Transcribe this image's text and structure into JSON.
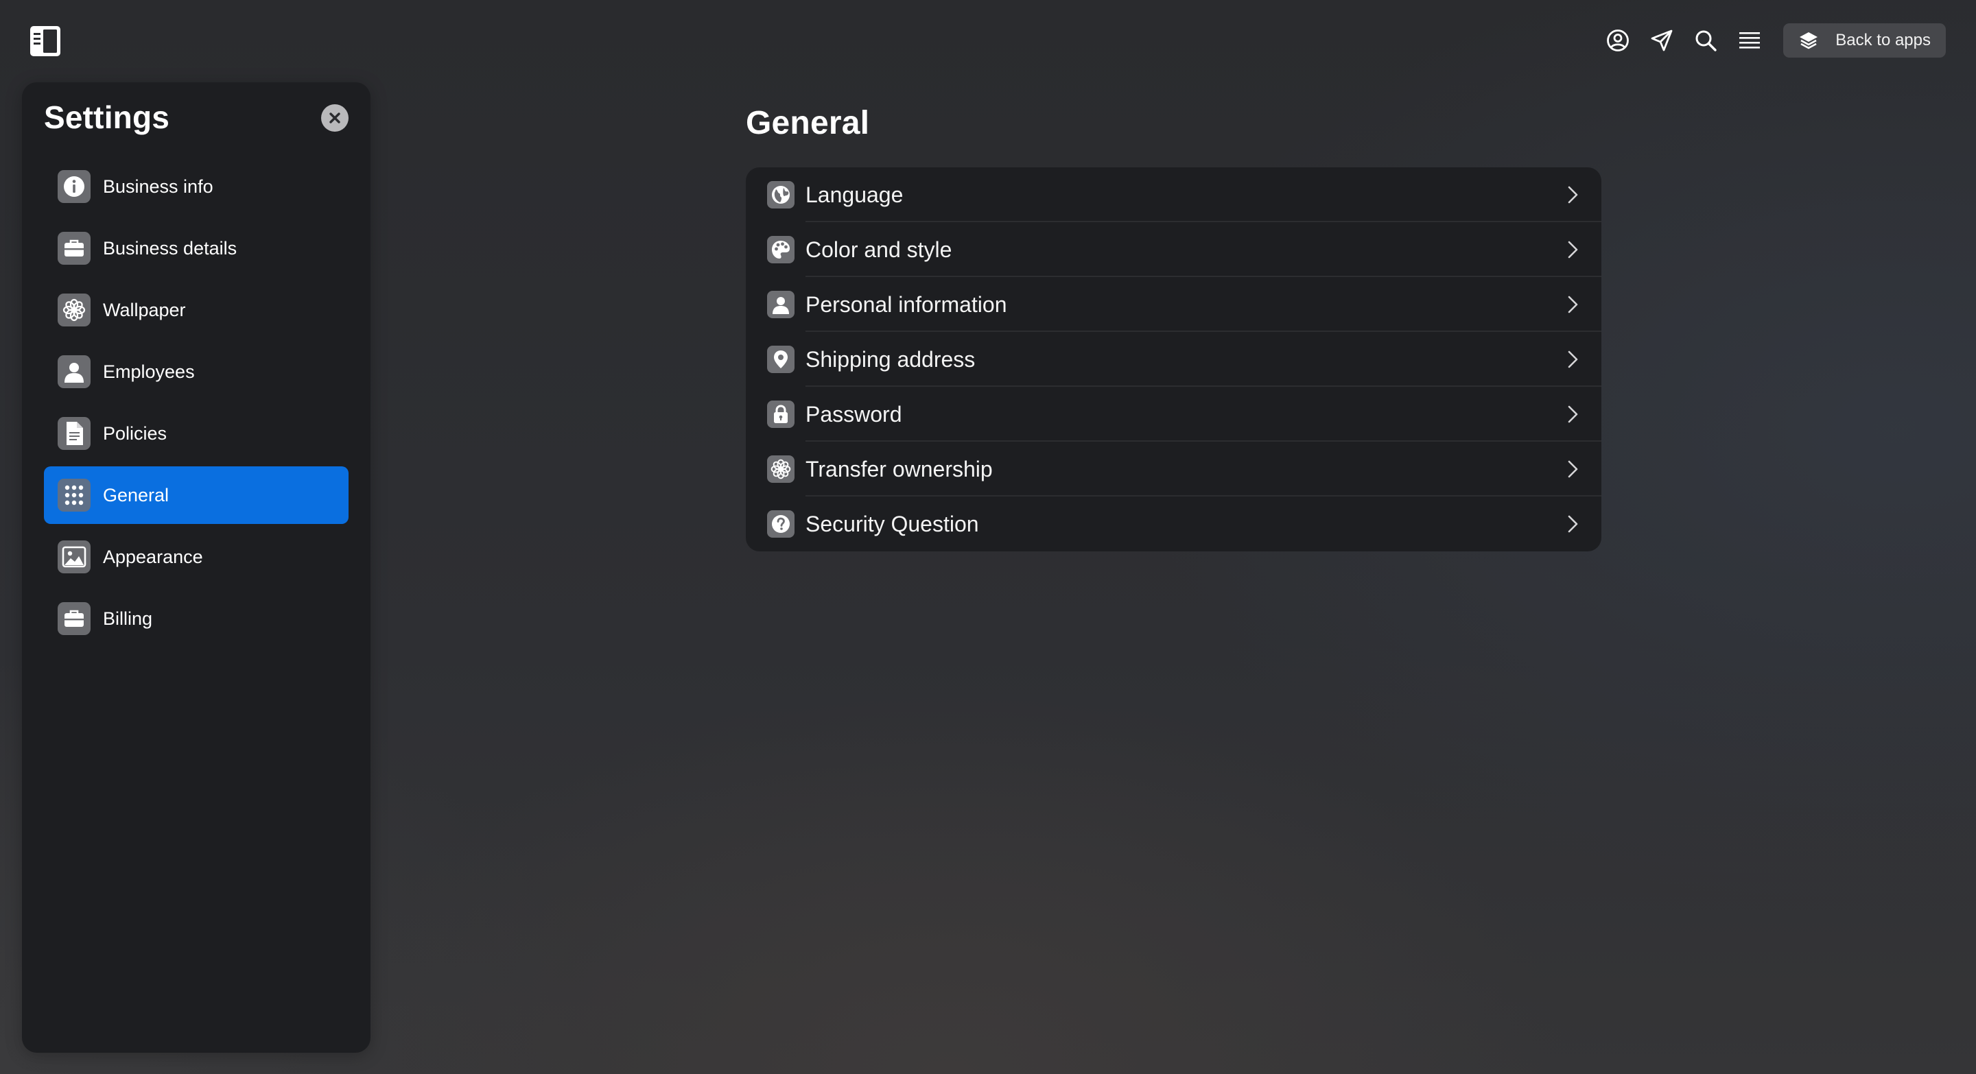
{
  "header": {
    "sidebar_toggle_icon": "sidebar-icon",
    "icons": [
      "account-circle-icon",
      "send-icon",
      "search-icon",
      "menu-icon"
    ],
    "back_button": {
      "label": "Back to apps",
      "icon": "stack-icon"
    }
  },
  "settings_panel": {
    "title": "Settings",
    "close_icon": "close-icon",
    "items": [
      {
        "label": "Business info",
        "icon": "info-icon",
        "active": false
      },
      {
        "label": "Business details",
        "icon": "briefcase-icon",
        "active": false
      },
      {
        "label": "Wallpaper",
        "icon": "flower-icon",
        "active": false
      },
      {
        "label": "Employees",
        "icon": "person-icon",
        "active": false
      },
      {
        "label": "Policies",
        "icon": "document-icon",
        "active": false
      },
      {
        "label": "General",
        "icon": "grid-icon",
        "active": true
      },
      {
        "label": "Appearance",
        "icon": "image-icon",
        "active": false
      },
      {
        "label": "Billing",
        "icon": "briefcase-icon",
        "active": false
      }
    ]
  },
  "main": {
    "title": "General",
    "options": [
      {
        "label": "Language",
        "icon": "globe-icon"
      },
      {
        "label": "Color and style",
        "icon": "palette-icon"
      },
      {
        "label": "Personal information",
        "icon": "person-icon"
      },
      {
        "label": "Shipping address",
        "icon": "location-pin-icon"
      },
      {
        "label": "Password",
        "icon": "lock-icon"
      },
      {
        "label": "Transfer ownership",
        "icon": "flower-icon"
      },
      {
        "label": "Security Question",
        "icon": "question-icon"
      }
    ]
  },
  "colors": {
    "accent": "#0a6fe0",
    "panel_bg": "#1d1e21",
    "icon_tile": "#6a6b6f"
  }
}
